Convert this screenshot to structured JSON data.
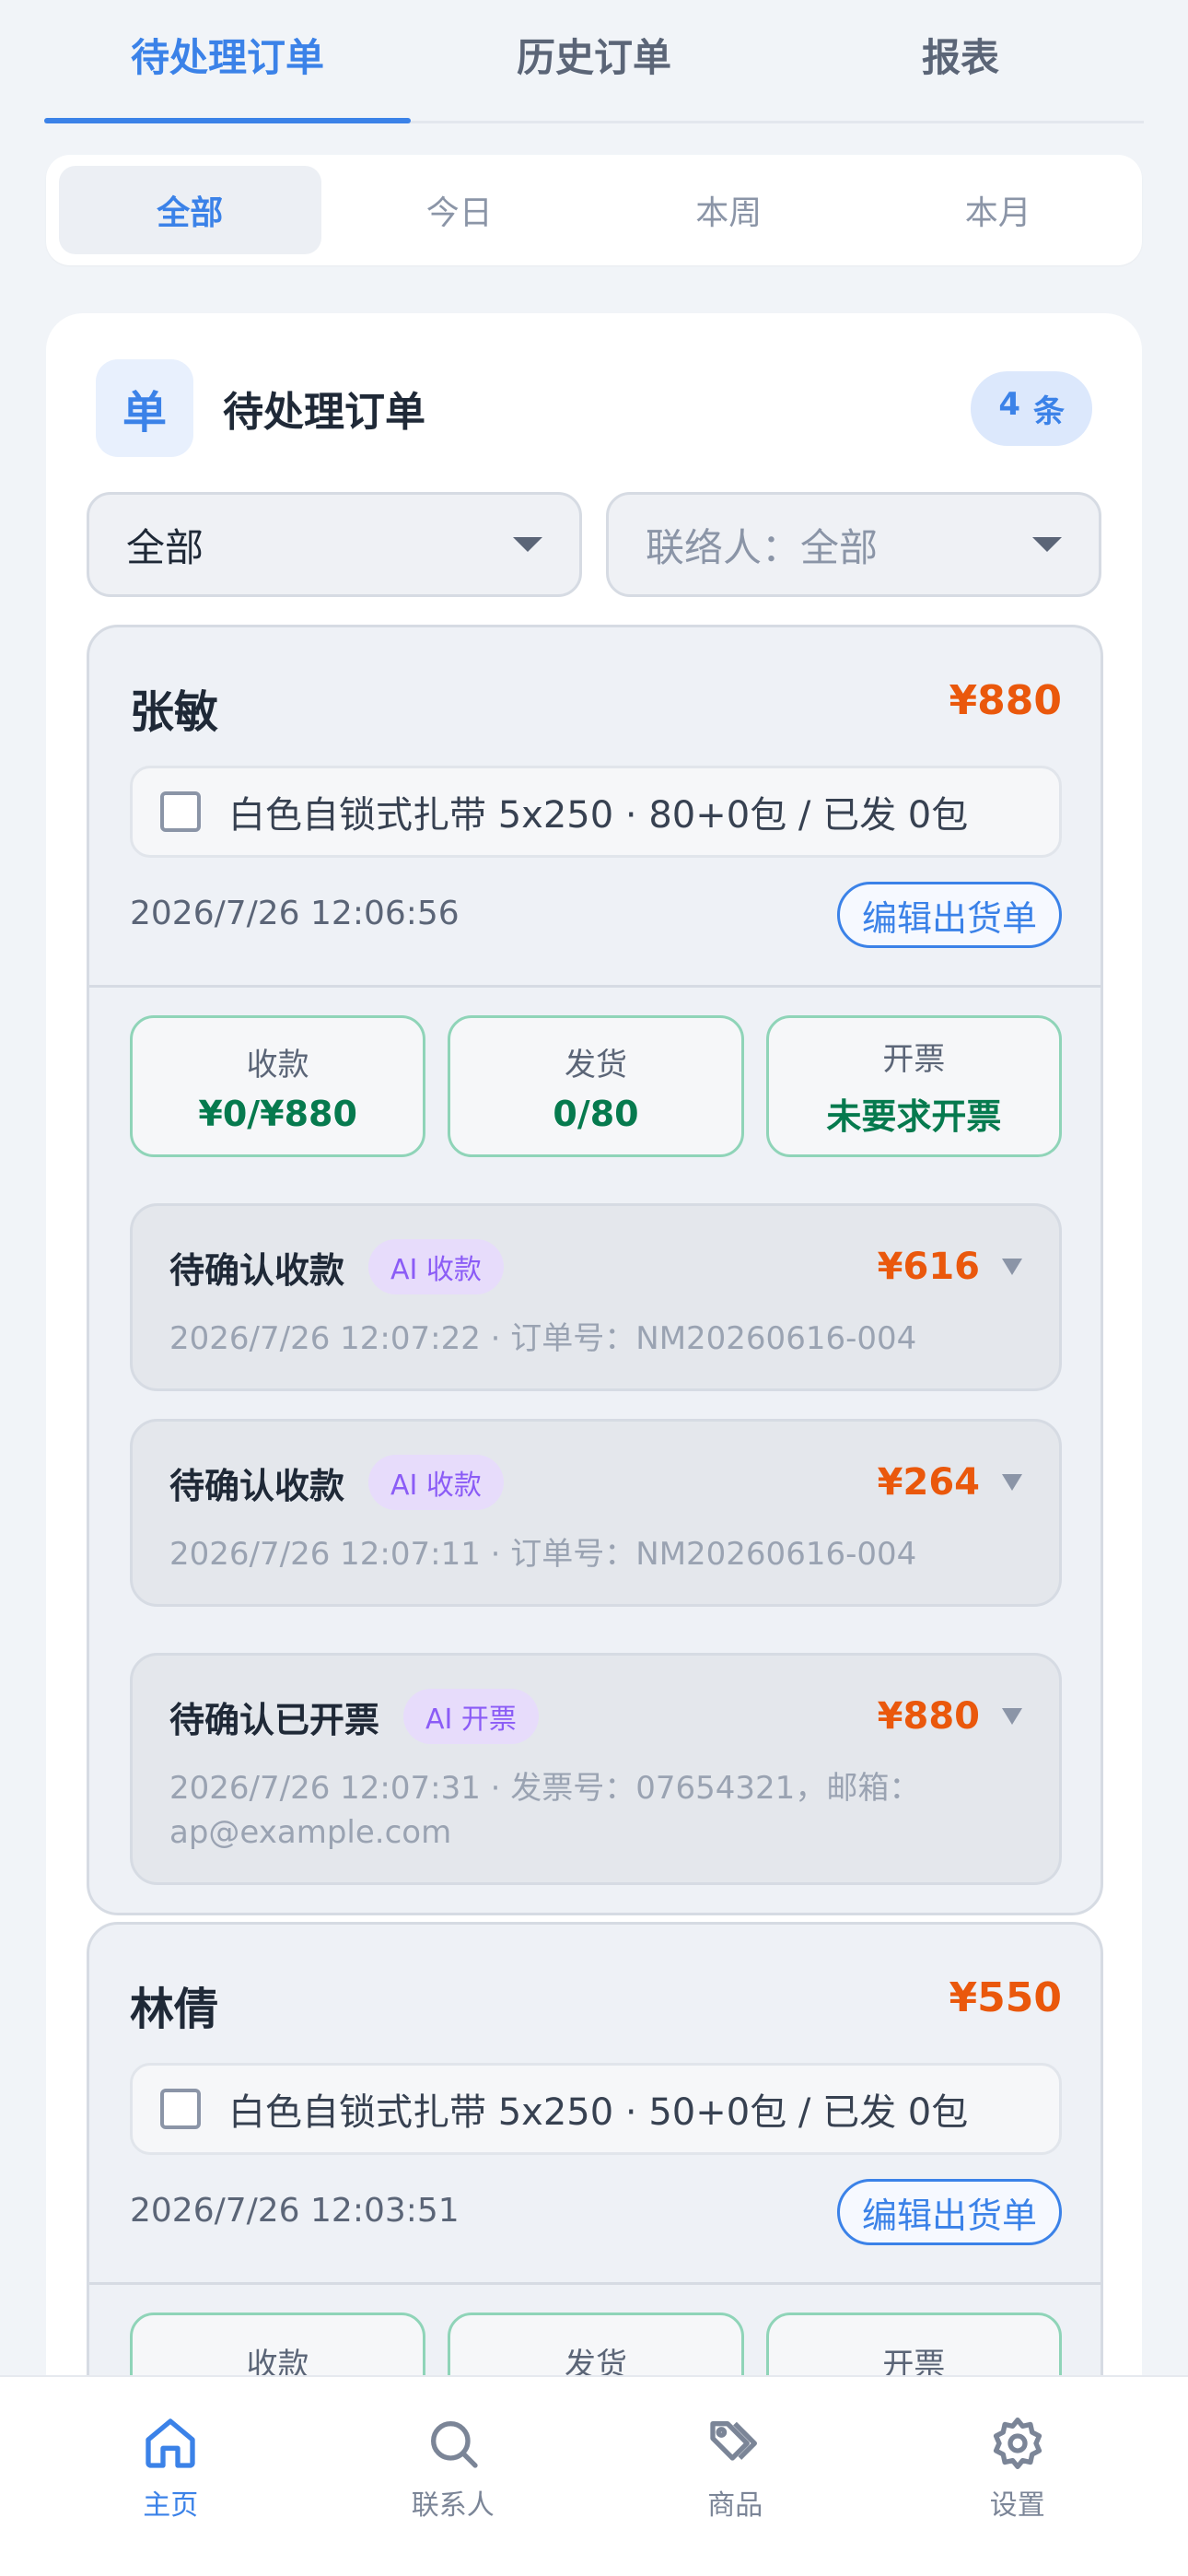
{
  "top_tabs": [
    {
      "label": "待处理订单",
      "active": true
    },
    {
      "label": "历史订单",
      "active": false
    },
    {
      "label": "报表",
      "active": false
    }
  ],
  "range": {
    "items": [
      "全部",
      "今日",
      "本周",
      "本月"
    ],
    "selected": "全部"
  },
  "panel": {
    "icon_text": "单",
    "title": "待处理订单",
    "count_value": "4",
    "count_unit": "条"
  },
  "filters": {
    "status_value": "全部",
    "contact_value": "联络人：全部"
  },
  "orders": [
    {
      "customer": "张敏",
      "total": "¥880",
      "item": "白色自锁式扎带 5x250 · 80+0包 / 已发 0包",
      "time": "2026/7/26 12:06:56",
      "edit_label": "编辑出货单",
      "stats": [
        {
          "label": "收款",
          "value": "¥0/¥880"
        },
        {
          "label": "发货",
          "value": "0/80"
        },
        {
          "label": "开票",
          "value": "未要求开票"
        }
      ],
      "pending": [
        {
          "title": "待确认收款",
          "tag": "AI 收款",
          "amount": "¥616",
          "sub": "2026/7/26 12:07:22 · 订单号：NM20260616-004"
        },
        {
          "title": "待确认收款",
          "tag": "AI 收款",
          "amount": "¥264",
          "sub": "2026/7/26 12:07:11 · 订单号：NM20260616-004"
        },
        {
          "title": "待确认已开票",
          "tag": "AI 开票",
          "amount": "¥880",
          "sub": "2026/7/26 12:07:31 · 发票号：07654321，邮箱：",
          "sub2": "ap@example.com"
        }
      ]
    },
    {
      "customer": "林倩",
      "total": "¥550",
      "item": "白色自锁式扎带 5x250 · 50+0包 / 已发 0包",
      "time": "2026/7/26 12:03:51",
      "edit_label": "编辑出货单",
      "stats": [
        {
          "label": "收款"
        },
        {
          "label": "发货"
        },
        {
          "label": "开票"
        }
      ]
    }
  ],
  "bottom_nav": [
    {
      "label": "主页",
      "icon": "home-icon",
      "active": true
    },
    {
      "label": "联系人",
      "icon": "search-icon",
      "active": false
    },
    {
      "label": "商品",
      "icon": "tag-icon",
      "active": false
    },
    {
      "label": "设置",
      "icon": "gear-icon",
      "active": false
    }
  ],
  "colors": {
    "accent": "#3b82e8",
    "amount": "#ea580c",
    "success": "#067a4e",
    "ai_tag": "#8b5cf6"
  }
}
